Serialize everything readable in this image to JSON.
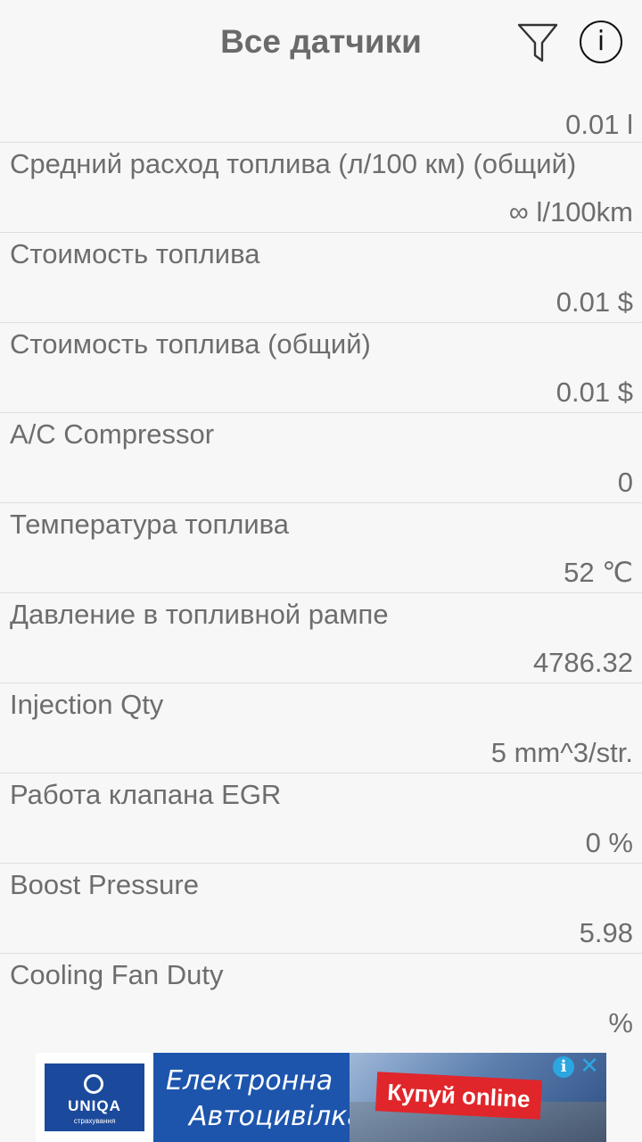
{
  "header": {
    "title": "Все датчики",
    "filter_icon": "filter-icon",
    "info_icon": "info-icon",
    "info_glyph": "i"
  },
  "first_value": "0.01  l",
  "sensors": [
    {
      "label": "Средний расход топлива (л/100 км) (общий)",
      "value": "∞  l/100km"
    },
    {
      "label": "Стоимость топлива",
      "value": "0.01  $"
    },
    {
      "label": "Стоимость топлива (общий)",
      "value": "0.01  $"
    },
    {
      "label": "A/C Compressor",
      "value": "0  "
    },
    {
      "label": "Температура топлива",
      "value": "52  ℃"
    },
    {
      "label": "Давление в топливной рампе",
      "value": "4786.32  "
    },
    {
      "label": "Injection Qty",
      "value": "5  mm^3/str."
    },
    {
      "label": "Работа клапана EGR",
      "value": "0  %"
    },
    {
      "label": "Boost Pressure",
      "value": "5.98  "
    },
    {
      "label": "Cooling Fan Duty",
      "value": "%"
    }
  ],
  "ad": {
    "brand": "UNIQA",
    "brand_sub": "страхування",
    "line1": "Електронна",
    "line2": "Автоцивілка",
    "cta": "Купуй online",
    "info_glyph": "i",
    "close_glyph": "✕"
  },
  "colors": {
    "background": "#f7f7f7",
    "text": "#6d6d6d",
    "divider": "#dedede",
    "ad_blue": "#1a4fa0",
    "ad_red": "#e0262b",
    "ad_icon": "#2ba6e0"
  }
}
